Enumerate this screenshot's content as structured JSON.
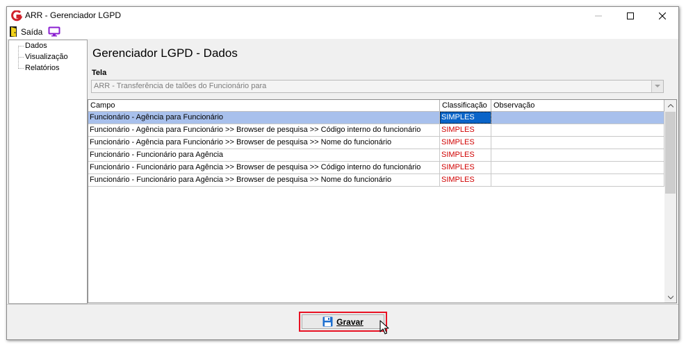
{
  "window": {
    "title": "ARR - Gerenciador LGPD"
  },
  "menu": {
    "exit_label": "Saída"
  },
  "tree": {
    "items": [
      "Dados",
      "Visualização",
      "Relatórios"
    ]
  },
  "main": {
    "title": "Gerenciador LGPD - Dados",
    "screen_label": "Tela",
    "screen_value": "ARR - Transferência de talões do Funcionário para"
  },
  "grid": {
    "columns": [
      "Campo",
      "Classificação",
      "Observação"
    ],
    "rows": [
      {
        "campo": "Funcionário - Agência para Funcionário",
        "classificacao": "SIMPLES",
        "observacao": ""
      },
      {
        "campo": "Funcionário - Agência para Funcionário >> Browser de pesquisa >> Código interno do funcionário",
        "classificacao": "SIMPLES",
        "observacao": ""
      },
      {
        "campo": "Funcionário - Agência para Funcionário >> Browser de pesquisa >> Nome do funcionário",
        "classificacao": "SIMPLES",
        "observacao": ""
      },
      {
        "campo": "Funcionário - Funcionário para Agência",
        "classificacao": "SIMPLES",
        "observacao": ""
      },
      {
        "campo": "Funcionário - Funcionário para Agência >> Browser de pesquisa >> Código interno do funcionário",
        "classificacao": "SIMPLES",
        "observacao": ""
      },
      {
        "campo": "Funcionário - Funcionário para Agência >> Browser de pesquisa >> Nome do funcionário",
        "classificacao": "SIMPLES",
        "observacao": ""
      }
    ]
  },
  "footer": {
    "save_label": "Gravar"
  },
  "colors": {
    "selection": "#a8c0ec",
    "classification_text": "#d00000",
    "highlight_border": "#e81123"
  },
  "icons": {
    "app": "app-logo-icon",
    "exit": "exit-door-icon",
    "monitor": "monitor-icon",
    "save": "floppy-disk-icon"
  }
}
